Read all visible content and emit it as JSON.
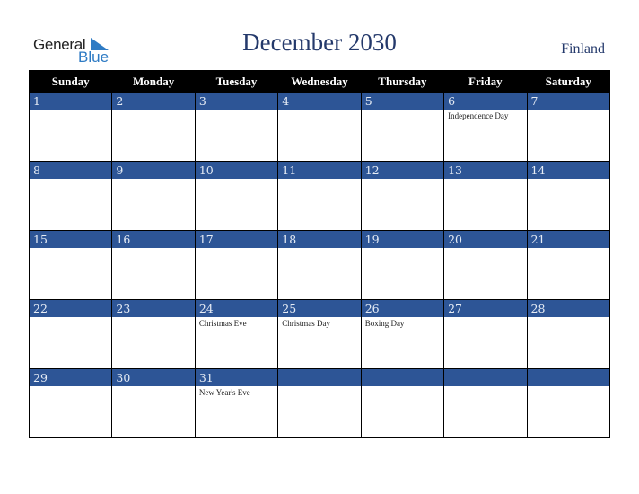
{
  "logo": {
    "line1": "General",
    "line2": "Blue",
    "accent": "#2e7bc4"
  },
  "title": "December 2030",
  "country": "Finland",
  "colors": {
    "header_bg": "#000000",
    "day_band": "#2d5596",
    "title": "#24396b"
  },
  "weekdays": [
    "Sunday",
    "Monday",
    "Tuesday",
    "Wednesday",
    "Thursday",
    "Friday",
    "Saturday"
  ],
  "weeks": [
    [
      {
        "day": "1",
        "holiday": ""
      },
      {
        "day": "2",
        "holiday": ""
      },
      {
        "day": "3",
        "holiday": ""
      },
      {
        "day": "4",
        "holiday": ""
      },
      {
        "day": "5",
        "holiday": ""
      },
      {
        "day": "6",
        "holiday": "Independence Day"
      },
      {
        "day": "7",
        "holiday": ""
      }
    ],
    [
      {
        "day": "8",
        "holiday": ""
      },
      {
        "day": "9",
        "holiday": ""
      },
      {
        "day": "10",
        "holiday": ""
      },
      {
        "day": "11",
        "holiday": ""
      },
      {
        "day": "12",
        "holiday": ""
      },
      {
        "day": "13",
        "holiday": ""
      },
      {
        "day": "14",
        "holiday": ""
      }
    ],
    [
      {
        "day": "15",
        "holiday": ""
      },
      {
        "day": "16",
        "holiday": ""
      },
      {
        "day": "17",
        "holiday": ""
      },
      {
        "day": "18",
        "holiday": ""
      },
      {
        "day": "19",
        "holiday": ""
      },
      {
        "day": "20",
        "holiday": ""
      },
      {
        "day": "21",
        "holiday": ""
      }
    ],
    [
      {
        "day": "22",
        "holiday": ""
      },
      {
        "day": "23",
        "holiday": ""
      },
      {
        "day": "24",
        "holiday": "Christmas Eve"
      },
      {
        "day": "25",
        "holiday": "Christmas Day"
      },
      {
        "day": "26",
        "holiday": "Boxing Day"
      },
      {
        "day": "27",
        "holiday": ""
      },
      {
        "day": "28",
        "holiday": ""
      }
    ],
    [
      {
        "day": "29",
        "holiday": ""
      },
      {
        "day": "30",
        "holiday": ""
      },
      {
        "day": "31",
        "holiday": "New Year's Eve"
      },
      {
        "day": "",
        "holiday": ""
      },
      {
        "day": "",
        "holiday": ""
      },
      {
        "day": "",
        "holiday": ""
      },
      {
        "day": "",
        "holiday": ""
      }
    ]
  ]
}
